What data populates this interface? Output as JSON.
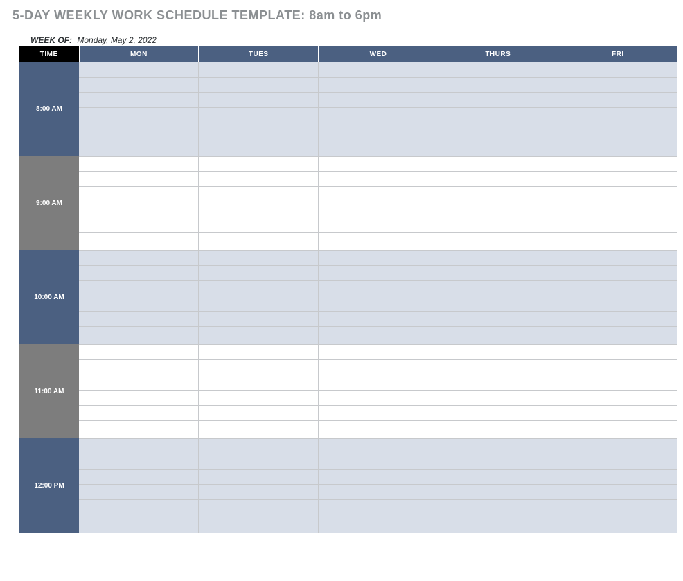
{
  "title": "5-DAY WEEKLY WORK SCHEDULE TEMPLATE: 8am to 6pm",
  "week_of_label": "WEEK OF:",
  "week_of_value": "Monday, May 2, 2022",
  "headers": {
    "time": "TIME",
    "days": [
      "MON",
      "TUES",
      "WED",
      "THURS",
      "FRI"
    ]
  },
  "hours": [
    {
      "label": "8:00 AM",
      "shade": "a"
    },
    {
      "label": "9:00 AM",
      "shade": "b"
    },
    {
      "label": "10:00 AM",
      "shade": "a"
    },
    {
      "label": "11:00 AM",
      "shade": "b"
    },
    {
      "label": "12:00 PM",
      "shade": "a"
    }
  ],
  "sub_rows_per_hour": 6
}
